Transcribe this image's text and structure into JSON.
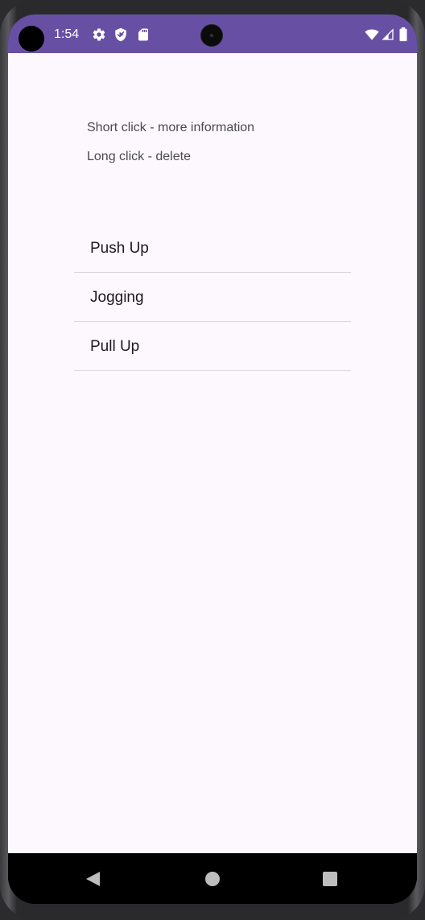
{
  "status_bar": {
    "time": "1:54",
    "background_color": "#6750a4",
    "left_icons": [
      "gear-icon",
      "shield-icon",
      "sd-card-icon"
    ],
    "right_icons": [
      "wifi-icon",
      "signal-icon",
      "battery-icon"
    ]
  },
  "hints": {
    "short_click": "Short click - more information",
    "long_click": "Long click - delete"
  },
  "exercises": [
    {
      "label": "Push Up"
    },
    {
      "label": "Jogging"
    },
    {
      "label": "Pull Up"
    }
  ],
  "nav_bar": {
    "buttons": [
      "back-icon",
      "home-icon",
      "recents-icon"
    ]
  },
  "colors": {
    "accent": "#6750a4",
    "background": "#fdf7fe",
    "divider": "#dcd6dd"
  }
}
